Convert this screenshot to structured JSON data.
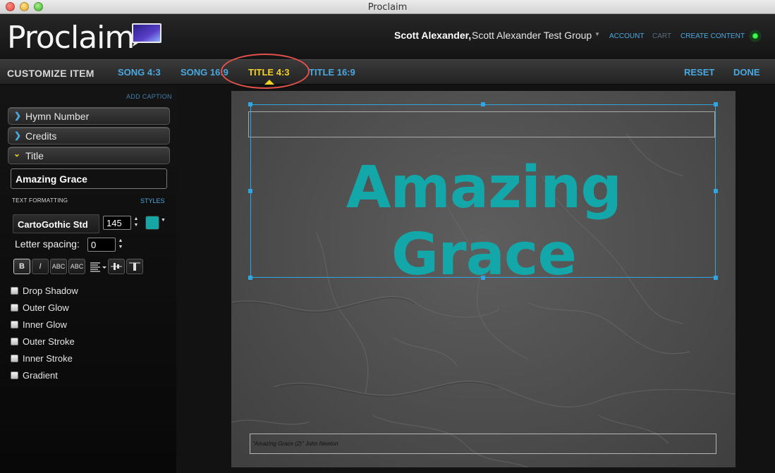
{
  "window": {
    "title": "Proclaim"
  },
  "header": {
    "logo_text": "Proclaim",
    "user_name": "Scott Alexander,",
    "group_name": "Scott Alexander Test Group",
    "links": {
      "account": "ACCOUNT",
      "cart": "CART",
      "create_content": "CREATE CONTENT"
    }
  },
  "toolbar": {
    "section_title": "CUSTOMIZE ITEM",
    "tabs": [
      {
        "label": "SONG 4:3",
        "active": false
      },
      {
        "label": "SONG 16:9",
        "active": false
      },
      {
        "label": "TITLE 4:3",
        "active": true
      },
      {
        "label": "TITLE 16:9",
        "active": false
      }
    ],
    "reset_label": "RESET",
    "done_label": "DONE"
  },
  "panel": {
    "add_caption": "ADD CAPTION",
    "sections": [
      {
        "label": "Hymn Number",
        "expanded": false
      },
      {
        "label": "Credits",
        "expanded": false
      },
      {
        "label": "Title",
        "expanded": true
      }
    ],
    "title_value": "Amazing Grace",
    "text_formatting_label": "TEXT FORMATTING",
    "styles_label": "STYLES",
    "font_family": "CartoGothic Std",
    "font_size": "145",
    "text_color": "#16a6a6",
    "letter_spacing_label": "Letter spacing:",
    "letter_spacing_value": "0",
    "format_buttons": [
      "B",
      "I",
      "ABC",
      "ABC"
    ],
    "effects": [
      "Drop Shadow",
      "Outer Glow",
      "Inner Glow",
      "Outer Stroke",
      "Inner Stroke",
      "Gradient"
    ]
  },
  "canvas": {
    "title_text": "Amazing Grace",
    "credits_text": "\"Amazing Grace (2)\" John Newton",
    "accent_color": "#13a7a9"
  }
}
